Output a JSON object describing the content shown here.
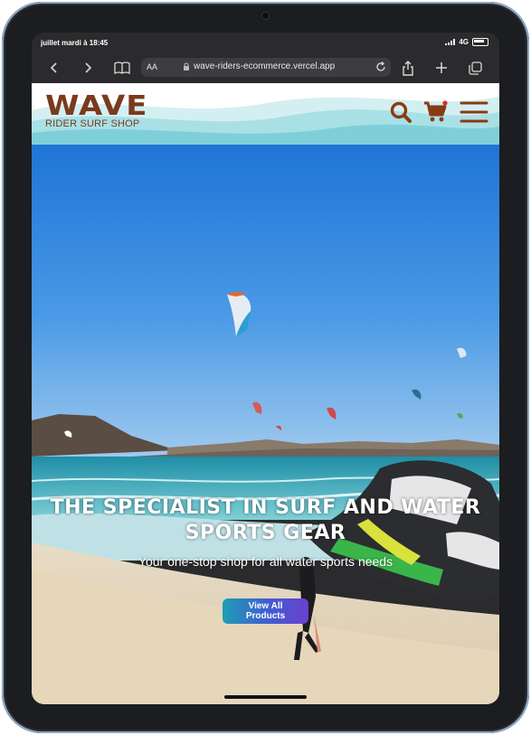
{
  "status_bar": {
    "time": "juillet mardi à 18:45",
    "network": "4G"
  },
  "browser": {
    "text_size_label": "AA",
    "url": "wave-riders-ecommerce.vercel.app"
  },
  "site": {
    "logo_word": "WAVE",
    "logo_tagline": "RIDER SURF SHOP"
  },
  "hero": {
    "title_line1": "THE SPECIALIST IN SURF AND WATER",
    "title_line2": "SPORTS GEAR",
    "subtitle": "Your one-stop shop for all water sports needs",
    "cta_label": "View All Products"
  },
  "colors": {
    "brand_brown": "#7a3a1c",
    "wave_teal": "#8fd3dc",
    "device_frame": "#1b1d20",
    "cta_start": "#1f9fb4",
    "cta_end": "#6a3fd0"
  },
  "icons": {
    "back": "chevron-left-icon",
    "forward": "chevron-right-icon",
    "bookmarks": "book-icon",
    "share": "share-icon",
    "new_tab": "plus-icon",
    "tabs": "tabs-icon",
    "search": "search-icon",
    "cart": "cart-icon",
    "menu": "hamburger-menu-icon"
  }
}
